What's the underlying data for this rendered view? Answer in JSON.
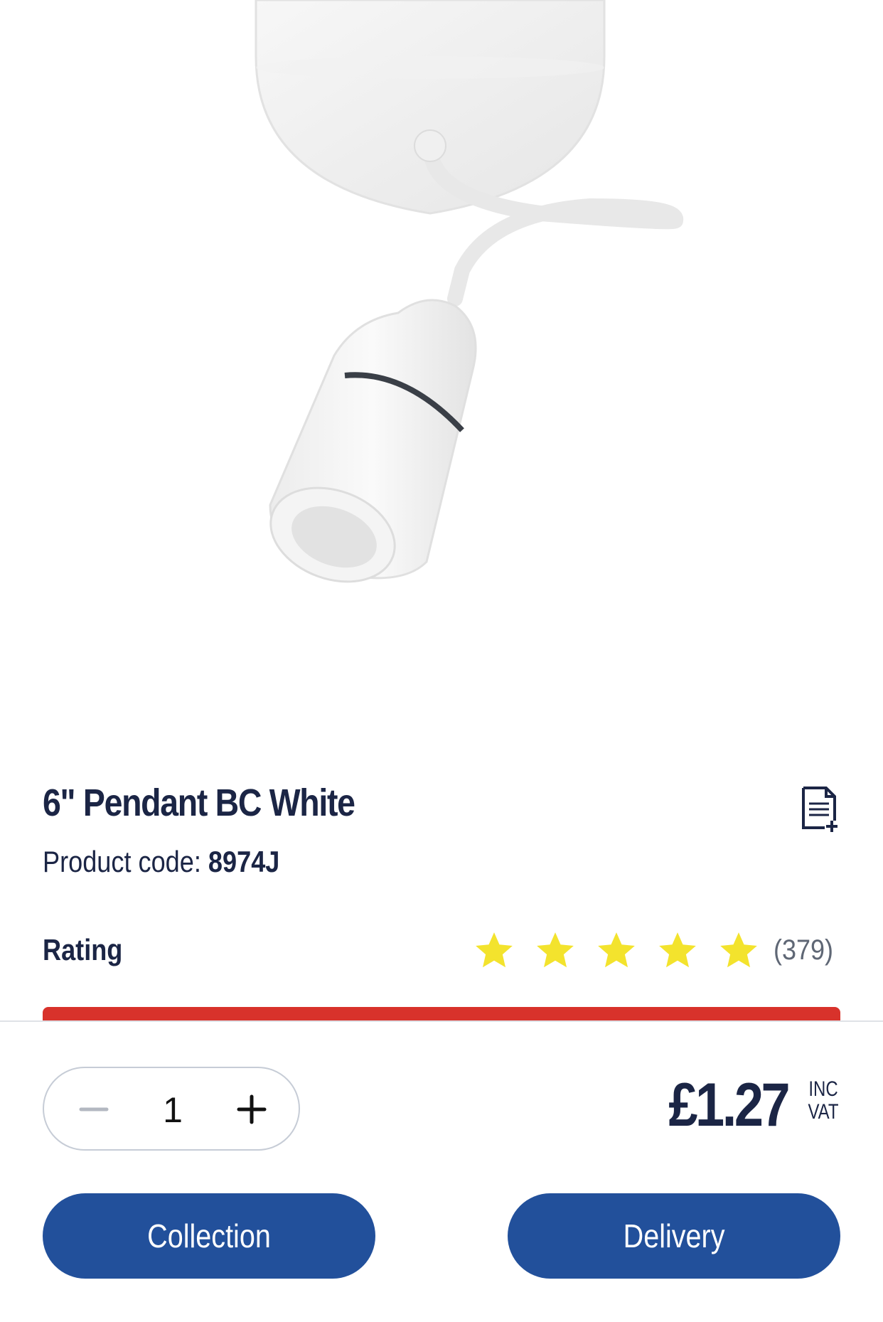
{
  "product": {
    "title": "6\" Pendant BC White",
    "code_label": "Product code:",
    "code_value": "8974J",
    "image_alt": "pendant-product-image"
  },
  "rating": {
    "label": "Rating",
    "stars": 5,
    "count": "(379)",
    "star_color": "#f3e32d"
  },
  "purchase": {
    "quantity": "1",
    "price": "£1.27",
    "vat_line1": "INC",
    "vat_line2": "VAT",
    "collection_label": "Collection",
    "delivery_label": "Delivery"
  },
  "colors": {
    "primary": "#22509b",
    "text": "#1b2545",
    "accent_red": "#d8322b"
  },
  "icons": {
    "add_to_list": "add-to-list-icon",
    "minus": "minus-icon",
    "plus": "plus-icon",
    "star": "star-icon"
  }
}
